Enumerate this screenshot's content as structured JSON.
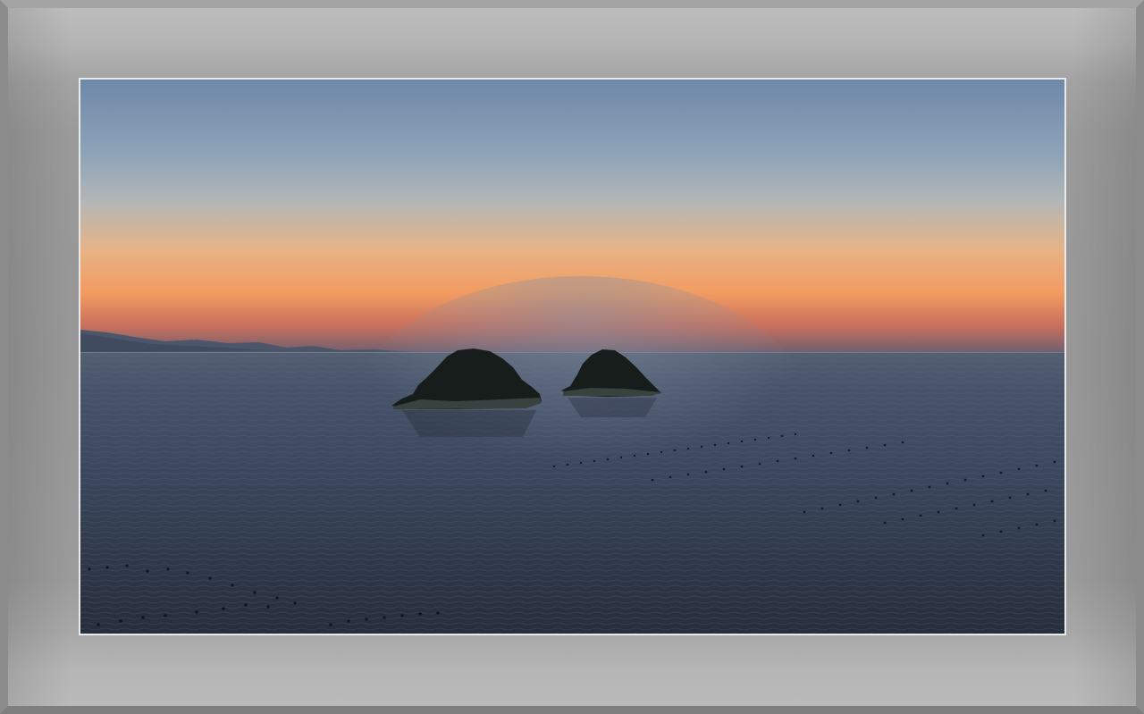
{
  "image": {
    "subject": "sunset-seascape",
    "colors": {
      "sky_top": "#6f8aaa",
      "sky_mid": "#9fb0bf",
      "sky_glow": "#f0a36a",
      "horizon_red": "#d96a55",
      "sea_dark": "#2b3344",
      "sea_mid": "#3d4a5e",
      "island": "#1b2220",
      "frame": "#999999",
      "mat_border": "#e9e9e9"
    }
  }
}
